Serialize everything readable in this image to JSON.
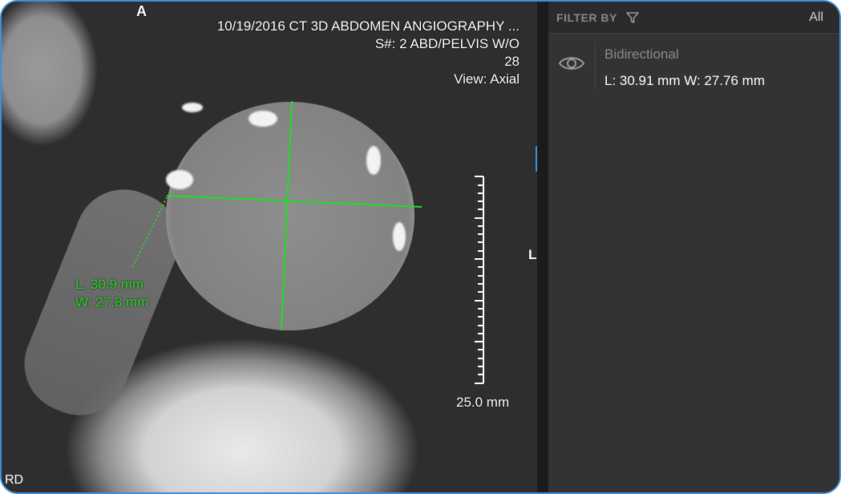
{
  "viewport": {
    "orientation_top": "A",
    "orientation_right": "L",
    "orientation_bottom_left": "RD",
    "study_line": "10/19/2016  CT 3D ABDOMEN ANGIOGRAPHY ...",
    "series_line": "S#: 2  ABD/PELVIS W/O",
    "image_number": "28",
    "view_line": "View: Axial",
    "scale_label": "25.0 mm",
    "measurement_length": "L: 30.9 mm",
    "measurement_width": "W: 27.8 mm",
    "measurement_color": "#22dd22"
  },
  "panel": {
    "filter_label": "FILTER BY",
    "filter_icon": "funnel-icon",
    "filter_value": "All",
    "measurements": [
      {
        "type": "Bidirectional",
        "value": "L: 30.91 mm W: 27.76 mm",
        "icon": "eye-icon"
      }
    ]
  },
  "colors": {
    "accent": "#3d8fe0",
    "panel_bg": "#333333",
    "measurement": "#22dd22"
  }
}
